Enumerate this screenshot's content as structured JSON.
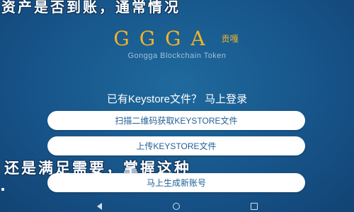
{
  "overlay": {
    "top_text": "资产是否到账，通常情况",
    "middle_text": "还是满足需要，掌握这种"
  },
  "brand": {
    "logo_text": "GGGA",
    "logo_cn": "贡嘎",
    "tagline": "Gongga Blockchain Token"
  },
  "login": {
    "question": "已有Keystore文件？ 马上登录",
    "scan_button": "扫描二维码获取KEYSTORE文件",
    "upload_button": "上传KEYSTORE文件",
    "create_button": "马上生成新账号"
  },
  "nav": {
    "back_icon": "back-triangle",
    "home_icon": "home-circle",
    "recent_icon": "recent-square"
  }
}
